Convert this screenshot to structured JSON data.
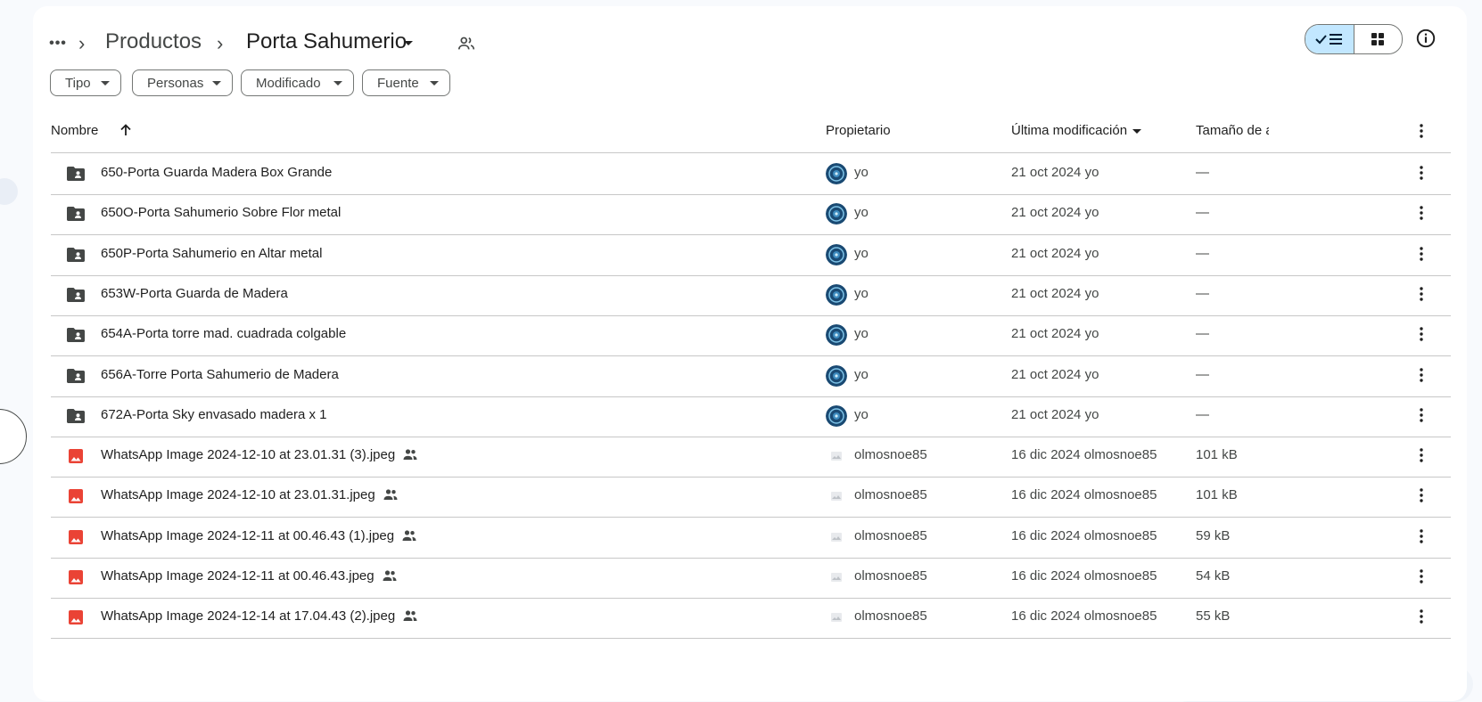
{
  "breadcrumb": {
    "parent": "Productos",
    "current": "Porta Sahumerio"
  },
  "filters": [
    {
      "label": "Tipo"
    },
    {
      "label": "Personas"
    },
    {
      "label": "Modificado"
    },
    {
      "label": "Fuente"
    }
  ],
  "columns": {
    "name": "Nombre",
    "owner": "Propietario",
    "modified": "Última modificación",
    "size": "Tamaño de a"
  },
  "rows": [
    {
      "type": "shared-folder",
      "name": "650-Porta Guarda Madera Box Grande",
      "owner": "yo",
      "date": "21 oct 2024",
      "modified_by": "yo",
      "size": "—",
      "shared": false
    },
    {
      "type": "shared-folder",
      "name": "650O-Porta Sahumerio Sobre Flor metal",
      "owner": "yo",
      "date": "21 oct 2024",
      "modified_by": "yo",
      "size": "—",
      "shared": false
    },
    {
      "type": "shared-folder",
      "name": "650P-Porta Sahumerio en Altar metal",
      "owner": "yo",
      "date": "21 oct 2024",
      "modified_by": "yo",
      "size": "—",
      "shared": false
    },
    {
      "type": "shared-folder",
      "name": "653W-Porta Guarda de Madera",
      "owner": "yo",
      "date": "21 oct 2024",
      "modified_by": "yo",
      "size": "—",
      "shared": false
    },
    {
      "type": "shared-folder",
      "name": "654A-Porta torre mad. cuadrada colgable",
      "owner": "yo",
      "date": "21 oct 2024",
      "modified_by": "yo",
      "size": "—",
      "shared": false
    },
    {
      "type": "shared-folder",
      "name": "656A-Torre Porta Sahumerio de Madera",
      "owner": "yo",
      "date": "21 oct 2024",
      "modified_by": "yo",
      "size": "—",
      "shared": false
    },
    {
      "type": "shared-folder",
      "name": "672A-Porta Sky envasado madera x 1",
      "owner": "yo",
      "date": "21 oct 2024",
      "modified_by": "yo",
      "size": "—",
      "shared": false
    },
    {
      "type": "image",
      "name": "WhatsApp Image 2024-12-10 at 23.01.31 (3).jpeg",
      "owner": "olmosnoe85",
      "date": "16 dic 2024",
      "modified_by": "olmosnoe85",
      "size": "101 kB",
      "shared": true
    },
    {
      "type": "image",
      "name": "WhatsApp Image 2024-12-10 at 23.01.31.jpeg",
      "owner": "olmosnoe85",
      "date": "16 dic 2024",
      "modified_by": "olmosnoe85",
      "size": "101 kB",
      "shared": true
    },
    {
      "type": "image",
      "name": "WhatsApp Image 2024-12-11 at 00.46.43 (1).jpeg",
      "owner": "olmosnoe85",
      "date": "16 dic 2024",
      "modified_by": "olmosnoe85",
      "size": "59 kB",
      "shared": true
    },
    {
      "type": "image",
      "name": "WhatsApp Image 2024-12-11 at 00.46.43.jpeg",
      "owner": "olmosnoe85",
      "date": "16 dic 2024",
      "modified_by": "olmosnoe85",
      "size": "54 kB",
      "shared": true
    },
    {
      "type": "image",
      "name": "WhatsApp Image 2024-12-14 at 17.04.43 (2).jpeg",
      "owner": "olmosnoe85",
      "date": "16 dic 2024",
      "modified_by": "olmosnoe85",
      "size": "55 kB",
      "shared": true
    }
  ],
  "colors": {
    "accent_toggle": "#c2e7ff",
    "image_icon": "#ea4335",
    "folder_icon": "#444746",
    "avatar_dark": "#1a4a73"
  },
  "icons": {
    "more": "more-horiz-icon",
    "crumb_separator": "chevron-right-icon",
    "shared_folder": "people-outline-icon",
    "list_view": "check-list-icon",
    "grid_view": "grid-icon",
    "info": "info-icon",
    "sort": "arrow-up-icon",
    "row_menu": "more-vert-icon"
  }
}
